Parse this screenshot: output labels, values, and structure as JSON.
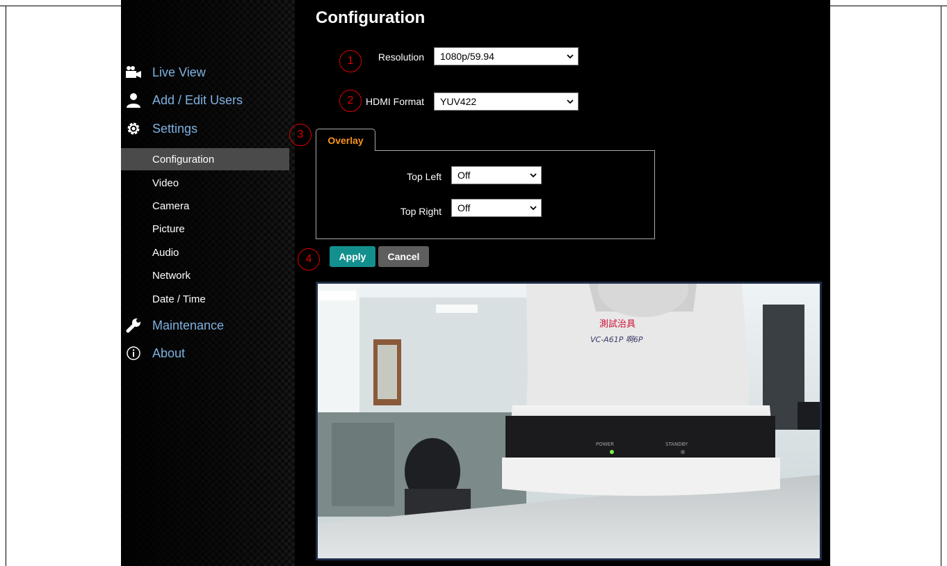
{
  "page_title": "Configuration",
  "sidebar": {
    "main_items": [
      {
        "label": "Live View",
        "icon": "video-camera-icon"
      },
      {
        "label": "Add / Edit Users",
        "icon": "user-icon"
      },
      {
        "label": "Settings",
        "icon": "gear-icon"
      },
      {
        "label": "Maintenance",
        "icon": "wrench-icon"
      },
      {
        "label": "About",
        "icon": "info-icon"
      }
    ],
    "sub_items": [
      "Configuration",
      "Video",
      "Camera",
      "Picture",
      "Audio",
      "Network",
      "Date / Time"
    ],
    "active_sub_item": "Configuration"
  },
  "form": {
    "resolution": {
      "label": "Resolution",
      "value": "1080p/59.94"
    },
    "hdmi_format": {
      "label": "HDMI Format",
      "value": "YUV422"
    }
  },
  "overlay": {
    "tab_label": "Overlay",
    "top_left": {
      "label": "Top Left",
      "value": "Off"
    },
    "top_right": {
      "label": "Top Right",
      "value": "Off"
    }
  },
  "buttons": {
    "apply": "Apply",
    "cancel": "Cancel"
  },
  "callouts": [
    "1",
    "2",
    "3",
    "4"
  ],
  "video_preview": {
    "device_label": "測試治具",
    "handwritten_note": "VC-A61P 啊6P",
    "power_label": "POWER",
    "standby_label": "STANDBY"
  },
  "colors": {
    "accent_teal": "#138f8e",
    "tab_orange": "#f7941d",
    "callout_red": "#e00000",
    "nav_link_blue": "#7fb1e0"
  }
}
